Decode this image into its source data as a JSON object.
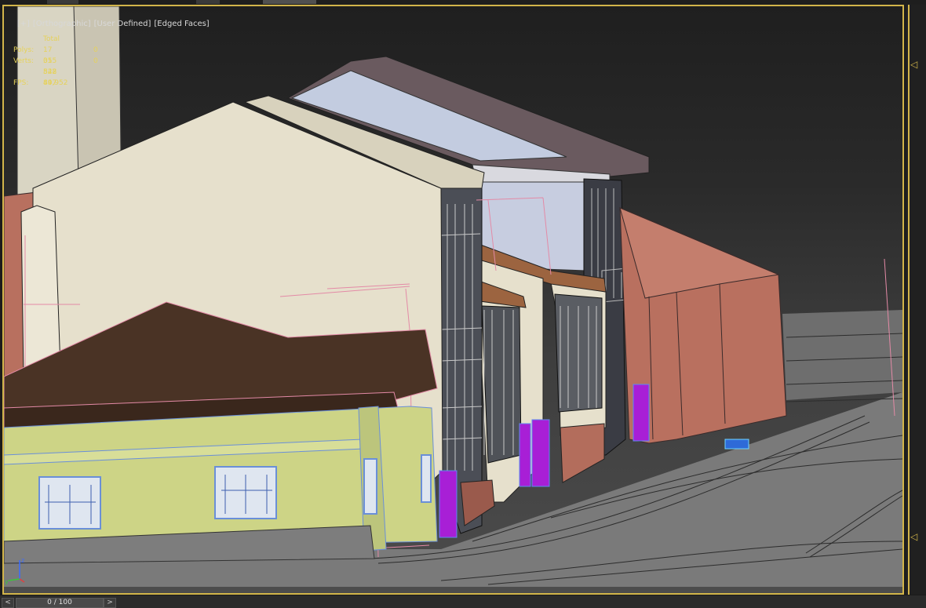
{
  "viewport": {
    "labels": [
      "[+]",
      "[Orthographic]",
      "[User Defined]",
      "[Edged Faces]"
    ]
  },
  "stats": {
    "header": "Total",
    "polys_label": "Polys:",
    "polys_total": "17 015 828",
    "polys_sel": "0",
    "verts_label": "Verts:",
    "verts_total": "35 542 497",
    "verts_sel": "0",
    "fps_label": "FPS:",
    "fps_value": "84,952"
  },
  "timeline": {
    "prev_icon": "<",
    "frame": "0 / 100",
    "next_icon": ">"
  },
  "gizmo": {
    "x": "x",
    "y": "y",
    "z": "z"
  },
  "icons": {
    "right_marker": "triangle-left-icon"
  },
  "colors": {
    "viewport_border": "#d2b54a",
    "stats_text": "#e6d25a",
    "cream_wall": "#e6e0cc",
    "yellow_wall": "#cdd486",
    "brick": "#b96f5f",
    "roof_brown": "#4a3325",
    "violet_door": "#a81fd6",
    "ground_grey": "#777777"
  }
}
